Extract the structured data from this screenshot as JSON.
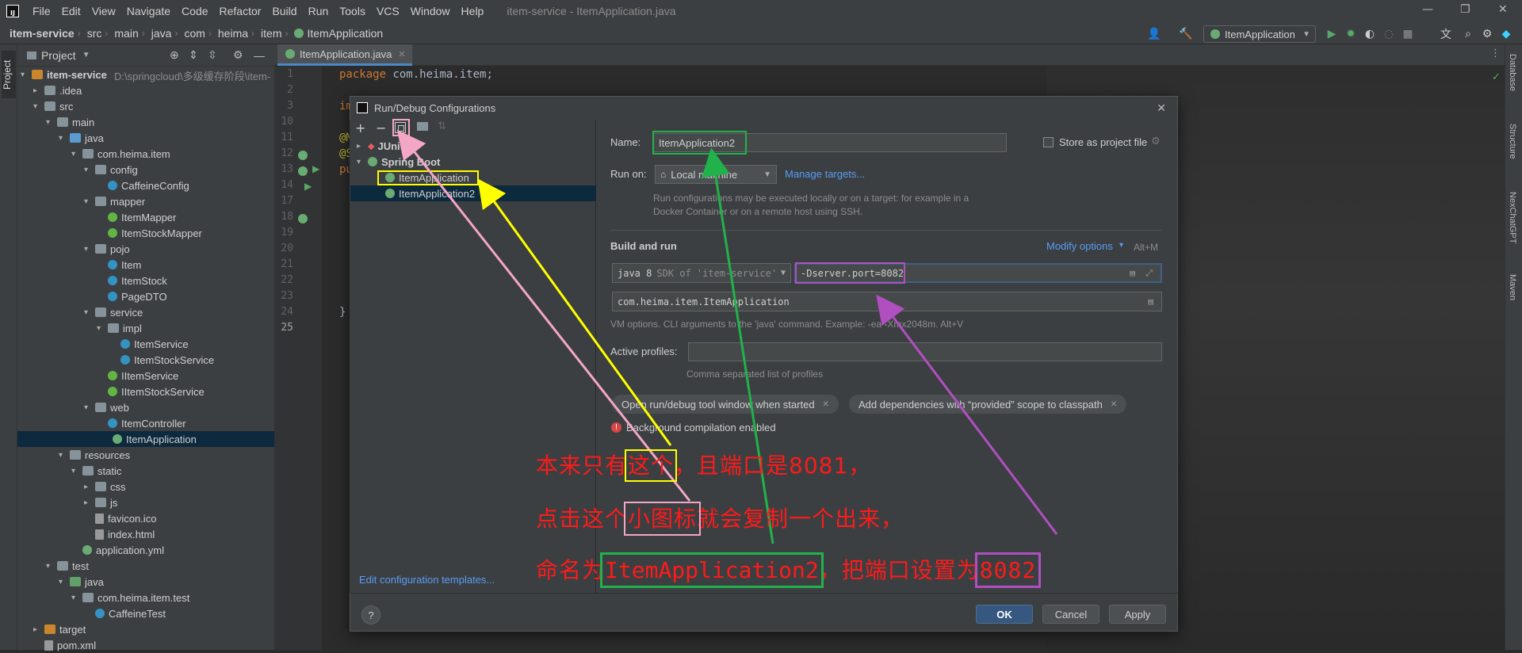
{
  "menubar": {
    "items": [
      "File",
      "Edit",
      "View",
      "Navigate",
      "Code",
      "Refactor",
      "Build",
      "Run",
      "Tools",
      "VCS",
      "Window",
      "Help"
    ],
    "window_title": "item-service - ItemApplication.java"
  },
  "breadcrumb": [
    "item-service",
    "src",
    "main",
    "java",
    "com",
    "heima",
    "item",
    "ItemApplication"
  ],
  "toolbar": {
    "run_config": "ItemApplication"
  },
  "tool_windows": {
    "left": "Project",
    "right": [
      "Database",
      "Structure",
      "NexChatGPT",
      "Maven"
    ]
  },
  "project": {
    "header": "Project",
    "root_path": "D:\\springcloud\\多级缓存阶段\\item-",
    "tree": [
      {
        "label": "item-service",
        "icon": "folder-orange",
        "depth": 0,
        "arrow": "▾"
      },
      {
        "label": ".idea",
        "icon": "folder",
        "depth": 1,
        "arrow": "▸"
      },
      {
        "label": "src",
        "icon": "folder",
        "depth": 1,
        "arrow": "▾"
      },
      {
        "label": "main",
        "icon": "folder",
        "depth": 2,
        "arrow": "▾"
      },
      {
        "label": "java",
        "icon": "folder-blue",
        "depth": 3,
        "arrow": "▾"
      },
      {
        "label": "com.heima.item",
        "icon": "folder",
        "depth": 4,
        "arrow": "▾"
      },
      {
        "label": "config",
        "icon": "folder",
        "depth": 5,
        "arrow": "▾"
      },
      {
        "label": "CaffeineConfig",
        "icon": "cls",
        "depth": 6,
        "arrow": ""
      },
      {
        "label": "mapper",
        "icon": "folder",
        "depth": 5,
        "arrow": "▾"
      },
      {
        "label": "ItemMapper",
        "icon": "ifc",
        "depth": 6,
        "arrow": ""
      },
      {
        "label": "ItemStockMapper",
        "icon": "ifc",
        "depth": 6,
        "arrow": ""
      },
      {
        "label": "pojo",
        "icon": "folder",
        "depth": 5,
        "arrow": "▾"
      },
      {
        "label": "Item",
        "icon": "cls",
        "depth": 6,
        "arrow": ""
      },
      {
        "label": "ItemStock",
        "icon": "cls",
        "depth": 6,
        "arrow": ""
      },
      {
        "label": "PageDTO",
        "icon": "cls",
        "depth": 6,
        "arrow": ""
      },
      {
        "label": "service",
        "icon": "folder",
        "depth": 5,
        "arrow": "▾"
      },
      {
        "label": "impl",
        "icon": "folder",
        "depth": 6,
        "arrow": "▾"
      },
      {
        "label": "ItemService",
        "icon": "cls",
        "depth": 7,
        "arrow": ""
      },
      {
        "label": "ItemStockService",
        "icon": "cls",
        "depth": 7,
        "arrow": ""
      },
      {
        "label": "IItemService",
        "icon": "ifc",
        "depth": 6,
        "arrow": ""
      },
      {
        "label": "IItemStockService",
        "icon": "ifc",
        "depth": 6,
        "arrow": ""
      },
      {
        "label": "web",
        "icon": "folder",
        "depth": 5,
        "arrow": "▾"
      },
      {
        "label": "ItemController",
        "icon": "cls",
        "depth": 6,
        "arrow": ""
      },
      {
        "label": "ItemApplication",
        "icon": "spring",
        "depth": 5,
        "arrow": "",
        "selected": true
      },
      {
        "label": "resources",
        "icon": "folder",
        "depth": 3,
        "arrow": "▾"
      },
      {
        "label": "static",
        "icon": "folder",
        "depth": 4,
        "arrow": "▾"
      },
      {
        "label": "css",
        "icon": "folder",
        "depth": 5,
        "arrow": "▸"
      },
      {
        "label": "js",
        "icon": "folder",
        "depth": 5,
        "arrow": "▸"
      },
      {
        "label": "favicon.ico",
        "icon": "file",
        "depth": 5,
        "arrow": ""
      },
      {
        "label": "index.html",
        "icon": "file",
        "depth": 5,
        "arrow": ""
      },
      {
        "label": "application.yml",
        "icon": "spring",
        "depth": 4,
        "arrow": ""
      },
      {
        "label": "test",
        "icon": "folder",
        "depth": 2,
        "arrow": "▾"
      },
      {
        "label": "java",
        "icon": "folder-green",
        "depth": 3,
        "arrow": "▾"
      },
      {
        "label": "com.heima.item.test",
        "icon": "folder",
        "depth": 4,
        "arrow": "▾"
      },
      {
        "label": "CaffeineTest",
        "icon": "cls",
        "depth": 5,
        "arrow": ""
      },
      {
        "label": "target",
        "icon": "folder-orange",
        "depth": 1,
        "arrow": "▸"
      },
      {
        "label": "pom.xml",
        "icon": "file",
        "depth": 1,
        "arrow": ""
      }
    ]
  },
  "editor": {
    "tab": "ItemApplication.java",
    "line_numbers": [
      "1",
      "2",
      "3",
      "10",
      "11",
      "12",
      "13",
      "14",
      "17",
      "18",
      "19",
      "20",
      "21",
      "22",
      "23",
      "24",
      "25"
    ],
    "code_line1_kw": "package",
    "code_line1_rest": " com.heima.item;",
    "code_line3": "im",
    "code_ann1": "@M",
    "code_ann2": "@S",
    "code_pub": "pu",
    "code_close": "}"
  },
  "dialog": {
    "title": "Run/Debug Configurations",
    "tree": {
      "junit": "JUnit",
      "springboot": "Spring Boot",
      "app1": "ItemApplication",
      "app2": "ItemApplication2"
    },
    "templates_link": "Edit configuration templates...",
    "name_label": "Name:",
    "name_value": "ItemApplication2",
    "store_label": "Store as project file",
    "runon_label": "Run on:",
    "runon_value": "Local machine",
    "manage_targets": "Manage targets...",
    "runon_hint": "Run configurations may be executed locally or on a target: for example in a Docker Container or on a remote host using SSH.",
    "build_run": "Build and run",
    "modify_options": "Modify options",
    "modify_shortcut": "Alt+M",
    "jdk": "java 8",
    "jdk_sdk": "SDK of 'item-service'",
    "vm_options": "-Dserver.port=8082",
    "main_class": "com.heima.item.ItemApplication",
    "vm_hint": "VM options. CLI arguments to the 'java' command. Example: -ea -Xmx2048m. Alt+V",
    "profiles_label": "Active profiles:",
    "profiles_value": "",
    "profiles_hint": "Comma separated list of profiles",
    "chip1": "Open run/debug tool window when started",
    "chip2": "Add dependencies with “provided” scope to classpath",
    "bg_compile": "Background compilation enabled",
    "ok": "OK",
    "cancel": "Cancel",
    "apply": "Apply",
    "help": "?"
  },
  "annotations": {
    "line1_a": "本来只有",
    "line1_b": "这个",
    "line1_c": "，且端口是8081，",
    "line2_a": "点击这个",
    "line2_b": "小图标",
    "line2_c": "就会复制一个出来，",
    "line3_a": "命名为",
    "line3_b": "ItemApplication2",
    "line3_c": "，把端口设置为",
    "line3_d": "8082",
    "colors": {
      "yellow": "#ffff00",
      "pink": "#f4a6c6",
      "green": "#21b24b",
      "purple": "#b04fc0",
      "text": "#ff1a1a"
    }
  }
}
